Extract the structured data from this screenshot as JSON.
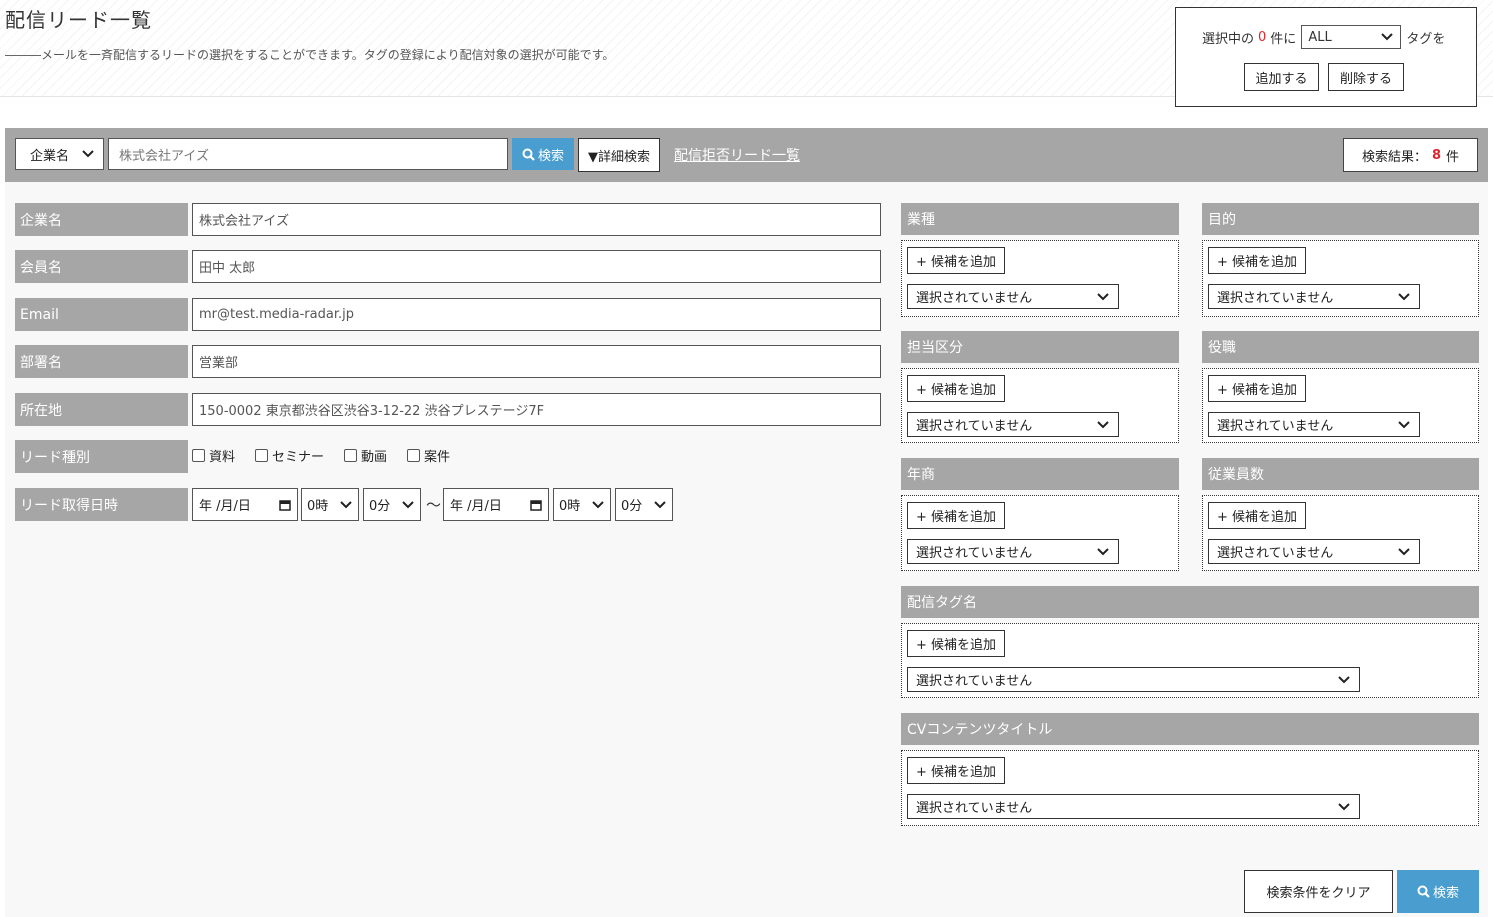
{
  "header": {
    "title": "配信リード一覧",
    "description": "―――メールを一斉配信するリードの選択をすることができます。タグの登録により配信対象の選択が可能です。"
  },
  "tag_box": {
    "prefix": "選択中の",
    "count": "0",
    "count_suffix": "件に",
    "tag_select_value": "ALL",
    "suffix": "タグを",
    "add_label": "追加する",
    "delete_label": "削除する"
  },
  "search_bar": {
    "field_select": "企業名",
    "query": "株式会社アイズ",
    "search_label": "検索",
    "advanced_label": "▼詳細検索",
    "refusal_link": "配信拒否リード一覧",
    "result_prefix": "検索結果：",
    "result_count": "8",
    "result_suffix": "件"
  },
  "fields": {
    "company": {
      "label": "企業名",
      "value": "株式会社アイズ"
    },
    "member": {
      "label": "会員名",
      "value": "田中 太郎"
    },
    "email": {
      "label": "Email",
      "value": "mr@test.media-radar.jp"
    },
    "department": {
      "label": "部署名",
      "value": "営業部"
    },
    "address": {
      "label": "所在地",
      "value": "150-0002 東京都渋谷区渋谷3-12-22 渋谷プレステージ7F"
    },
    "lead_type": {
      "label": "リード種別",
      "options": [
        "資料",
        "セミナー",
        "動画",
        "案件"
      ]
    },
    "lead_date": {
      "label": "リード取得日時",
      "date_placeholder": "年 /月/日",
      "hour": "0時",
      "minute": "0分",
      "separator": "〜"
    }
  },
  "panels": {
    "add_label": "+ 候補を追加",
    "none_selected": "選択されていません",
    "industry": "業種",
    "purpose": "目的",
    "division": "担当区分",
    "position": "役職",
    "revenue": "年商",
    "employees": "従業員数",
    "delivery_tag": "配信タグ名",
    "cv_content": "CVコンテンツタイトル"
  },
  "footer": {
    "clear_label": "検索条件をクリア",
    "search_label": "検索"
  },
  "colors": {
    "accent": "#4a9ecf",
    "bar_gray": "#a6a6a6",
    "highlight_red": "#e0262f"
  }
}
